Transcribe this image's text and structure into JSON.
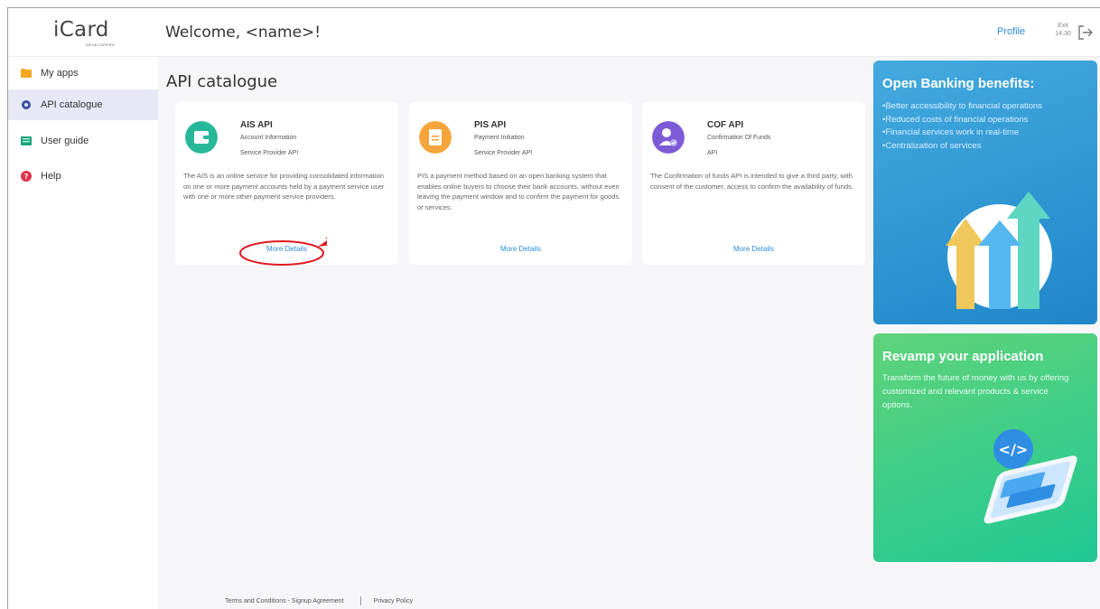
{
  "header": {
    "logo_text": "iCard",
    "logo_sub": "DEVELOPERS",
    "welcome": "Welcome, <name>!",
    "profile": "Profile",
    "exit_label": "Exit",
    "exit_time": "14:30"
  },
  "sidebar": {
    "items": [
      {
        "label": "My apps",
        "icon": "folder-icon",
        "color": "#f5a623"
      },
      {
        "label": "API catalogue",
        "icon": "gear-icon",
        "color": "#3a4ea8",
        "active": true
      },
      {
        "label": "User guide",
        "icon": "book-icon",
        "color": "#1aa57a"
      },
      {
        "label": "Help",
        "icon": "help-icon",
        "color": "#e0334a"
      }
    ]
  },
  "main": {
    "title": "API catalogue",
    "cards": [
      {
        "title": "AIS API",
        "sub1": "Account Information",
        "sub2": "Service Provider API",
        "desc": "The AIS  is an online service for providing consolidated information on one or more payment accounts held by a payment service user with one or more other payment service providers.",
        "link": "More Details",
        "icon": "wallet-icon",
        "color": "#27b899"
      },
      {
        "title": "PIS API",
        "sub1": "Payment Initiation",
        "sub2": "Service Provider API",
        "desc": "PIS a payment method based on an open banking system that enables online buyers to choose their bank accounts, without even leaving the payment window and to confirm the payment for goods or services.",
        "link": "More Details",
        "icon": "clipboard-icon",
        "color": "#f5a53a"
      },
      {
        "title": "COF API",
        "sub1": "Confirmation Of Funds",
        "sub2": "API",
        "desc": "The Confirmation of funds API is intended to give a third party, with consent of the customer, access to confirm the availability of funds.",
        "link": "More Details",
        "icon": "user-check-icon",
        "color": "#7e5bd6"
      }
    ]
  },
  "promos": {
    "banking": {
      "title": "Open Banking benefits:",
      "bullets": [
        "•Better accessibility to financial operations",
        "•Reduced costs of financial operations",
        "•Financial services work in real-time",
        "•Centralization of services"
      ]
    },
    "revamp": {
      "title": "Revamp your application",
      "text": "Transform the future of money with us by offering customized and relevant products & service options."
    }
  },
  "footer": {
    "terms": "Terms and Conditions - Signup Agreement",
    "privacy": "Privacy Policy"
  }
}
